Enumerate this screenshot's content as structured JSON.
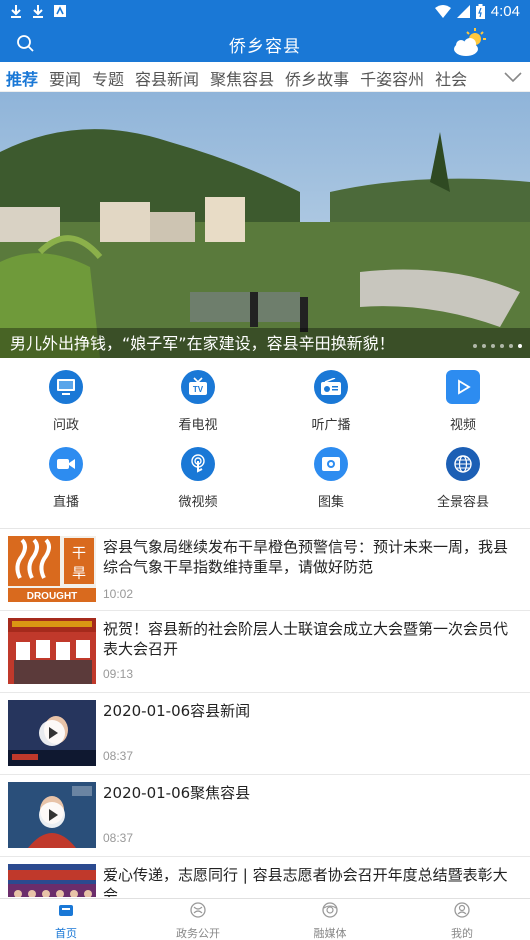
{
  "status_bar": {
    "time": "4:04",
    "left_icons": [
      "download-icon",
      "download-icon",
      "app-notification-icon"
    ],
    "right_icons": [
      "wifi-icon",
      "signal-icon",
      "battery-icon"
    ]
  },
  "header": {
    "title": "侨乡容县",
    "background": "#1a78d6"
  },
  "channels": {
    "tabs": [
      "推荐",
      "要闻",
      "专题",
      "容县新闻",
      "聚焦容县",
      "侨乡故事",
      "千姿容州",
      "社会"
    ],
    "active_index": 0
  },
  "banner": {
    "caption": "男儿外出挣钱，“娘子军”在家建设，容县辛田换新貌！",
    "slide_count": 6,
    "active_slide": 5
  },
  "functions": [
    {
      "label": "问政",
      "icon": "monitor-icon",
      "color": "#1a78d6"
    },
    {
      "label": "看电视",
      "icon": "tv-icon",
      "color": "#1a78d6"
    },
    {
      "label": "听广播",
      "icon": "radio-icon",
      "color": "#1a78d6"
    },
    {
      "label": "视频",
      "icon": "play-video-icon",
      "color": "#2d8cf0"
    },
    {
      "label": "直播",
      "icon": "camera-icon",
      "color": "#2d8cf0"
    },
    {
      "label": "微视频",
      "icon": "touch-icon",
      "color": "#1a78d6"
    },
    {
      "label": "图集",
      "icon": "photo-icon",
      "color": "#2d8cf0"
    },
    {
      "label": "全景容县",
      "icon": "globe-icon",
      "color": "#1c5fb5"
    }
  ],
  "news": [
    {
      "title": "容县气象局继续发布干旱橙色预警信号：预计未来一周，我县综合气象干旱指数维持重旱，请做好防范",
      "time": "10:02",
      "thumb_text": [
        "干",
        "旱",
        "DROUGHT"
      ],
      "video": false
    },
    {
      "title": "祝贺！容县新的社会阶层人士联谊会成立大会暨第一次会员代表大会召开",
      "time": "09:13",
      "video": false
    },
    {
      "title": "2020-01-06容县新闻",
      "time": "08:37",
      "video": true
    },
    {
      "title": "2020-01-06聚焦容县",
      "time": "08:37",
      "video": true
    },
    {
      "title": "爱心传递，志愿同行 | 容县志愿者协会召开年度总结暨表彰大会",
      "time": "",
      "video": false
    }
  ],
  "bottom_nav": [
    {
      "label": "首页",
      "icon": "home-icon",
      "active": true
    },
    {
      "label": "政务公开",
      "icon": "government-icon",
      "active": false
    },
    {
      "label": "融媒体",
      "icon": "media-icon",
      "active": false
    },
    {
      "label": "我的",
      "icon": "profile-icon",
      "active": false
    }
  ]
}
